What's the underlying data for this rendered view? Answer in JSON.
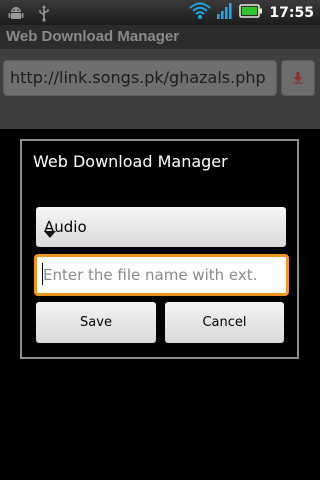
{
  "status_bar": {
    "clock": "17:55",
    "icons": [
      "android-debug-icon",
      "usb-icon",
      "wifi-icon",
      "signal-icon",
      "battery-icon"
    ]
  },
  "app": {
    "title": "Web Download Manager",
    "url_value": "http://link.songs.pk/ghazals.php",
    "download_icon": "download-icon"
  },
  "dialog": {
    "title": "Web Download Manager",
    "type_select": {
      "selected": "Audio"
    },
    "file_name": {
      "value": "",
      "placeholder": "Enter the file name with ext."
    },
    "save_label": "Save",
    "cancel_label": "Cancel"
  },
  "colors": {
    "focus_border": "#f0961e",
    "dialog_border": "#8c8c8c"
  }
}
